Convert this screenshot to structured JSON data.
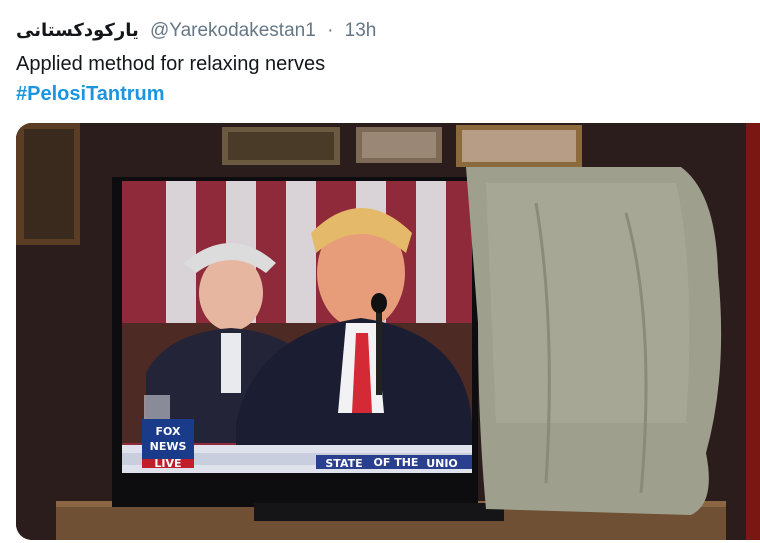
{
  "tweet": {
    "author_name": "يارکودکستانی",
    "handle": "@Yarekodakestan1",
    "separator": "·",
    "timestamp": "13h",
    "text": "Applied method for relaxing nerves",
    "hashtag": "#PelosiTantrum"
  },
  "media": {
    "network_logo_line1": "FOX",
    "network_logo_line2": "NEWS",
    "network_logo_line3": "LIVE",
    "chyron_text": "STATE",
    "chyron_small": "OF THE",
    "chyron_text_2": "UNIO"
  },
  "colors": {
    "handle_gray": "#657786",
    "hashtag_blue": "#1b95e0",
    "text_dark": "#14171a"
  }
}
